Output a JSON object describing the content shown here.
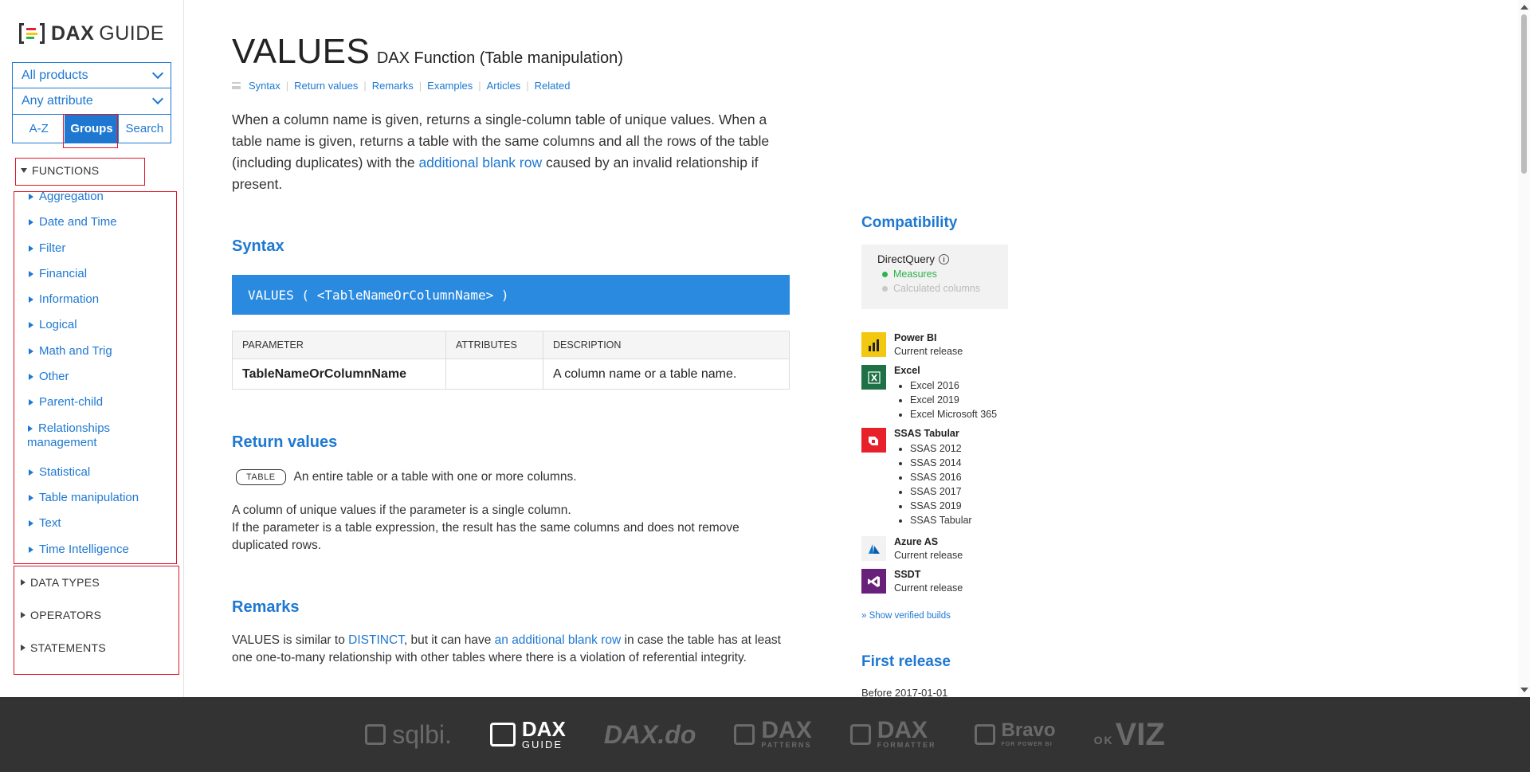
{
  "logo": {
    "dax": "DAX",
    "guide": "GUIDE"
  },
  "filters": {
    "products": "All products",
    "attribute": "Any attribute"
  },
  "view_tabs": [
    {
      "label": "A-Z",
      "active": false
    },
    {
      "label": "Groups",
      "active": true
    },
    {
      "label": "Search",
      "active": false
    }
  ],
  "categories": {
    "functions": "FUNCTIONS",
    "data_types": "DATA TYPES",
    "operators": "OPERATORS",
    "statements": "STATEMENTS"
  },
  "function_groups": [
    "Aggregation",
    "Date and Time",
    "Filter",
    "Financial",
    "Information",
    "Logical",
    "Math and Trig",
    "Other",
    "Parent-child",
    "Relationships management",
    "Statistical",
    "Table manipulation",
    "Text",
    "Time Intelligence"
  ],
  "page": {
    "name": "VALUES",
    "subtitle": "DAX Function (Table manipulation)",
    "toc": [
      "Syntax",
      "Return values",
      "Remarks",
      "Examples",
      "Articles",
      "Related"
    ],
    "desc_1": "When a column name is given, returns a single-column table of unique values. When a table name is given, returns a table with the same columns and all the rows of the table (including duplicates) with the ",
    "desc_link": "additional blank row",
    "desc_2": " caused by an invalid relationship if present."
  },
  "syntax": {
    "heading": "Syntax",
    "code": "VALUES ( <TableNameOrColumnName> )",
    "columns": [
      "PARAMETER",
      "ATTRIBUTES",
      "DESCRIPTION"
    ],
    "rows": [
      {
        "parameter": "TableNameOrColumnName",
        "attributes": "",
        "description": "A column name or a table name."
      }
    ]
  },
  "return_values": {
    "heading": "Return values",
    "badge": "TABLE",
    "badge_text": "An entire table or a table with one or more columns.",
    "line1": "A column of unique values if the parameter is a single column.",
    "line2": "If the parameter is a table expression, the result has the same columns and does not remove duplicated rows."
  },
  "remarks": {
    "heading": "Remarks",
    "t1": "VALUES is similar to ",
    "link1": "DISTINCT",
    "t2": ", but it can have ",
    "link2": "an additional blank row",
    "t3": " in case the table has at least one one-to-many relationship with other tables where there is a violation of referential integrity."
  },
  "compatibility": {
    "heading": "Compatibility",
    "directquery": "DirectQuery",
    "measures": "Measures",
    "calc_columns": "Calculated columns",
    "measures_color": "#2eb24a",
    "calc_color": "#c8c8c8"
  },
  "products": {
    "powerbi": {
      "name": "Power BI",
      "sub": "Current release",
      "color": "#f2c811"
    },
    "excel": {
      "name": "Excel",
      "versions": [
        "Excel 2016",
        "Excel 2019",
        "Excel Microsoft 365"
      ],
      "color": "#1e7145"
    },
    "ssas": {
      "name": "SSAS Tabular",
      "versions": [
        "SSAS 2012",
        "SSAS 2014",
        "SSAS 2016",
        "SSAS 2017",
        "SSAS 2019",
        "SSAS Tabular"
      ],
      "color": "#e8202a"
    },
    "azure": {
      "name": "Azure AS",
      "sub": "Current release",
      "color": "#0078d4"
    },
    "ssdt": {
      "name": "SSDT",
      "sub": "Current release",
      "color": "#68217a"
    }
  },
  "show_builds": "» Show verified builds",
  "first_release": {
    "heading": "First release",
    "value": "Before 2017-01-01"
  },
  "footer": {
    "sqlbi": "sqlbi.",
    "daxguide_dax": "DAX",
    "daxguide_guide": "GUIDE",
    "daxdo": "DAX.do",
    "patterns": "DAX",
    "patterns_sub": "PATTERNS",
    "formatter": "DAX",
    "formatter_sub": "FORMATTER",
    "bravo": "Bravo",
    "bravo_sub": "FOR POWER BI",
    "okviz": "VIZ",
    "okviz_pre": "OK"
  },
  "accent": "#1e78d2",
  "highlight": "#e0162b"
}
